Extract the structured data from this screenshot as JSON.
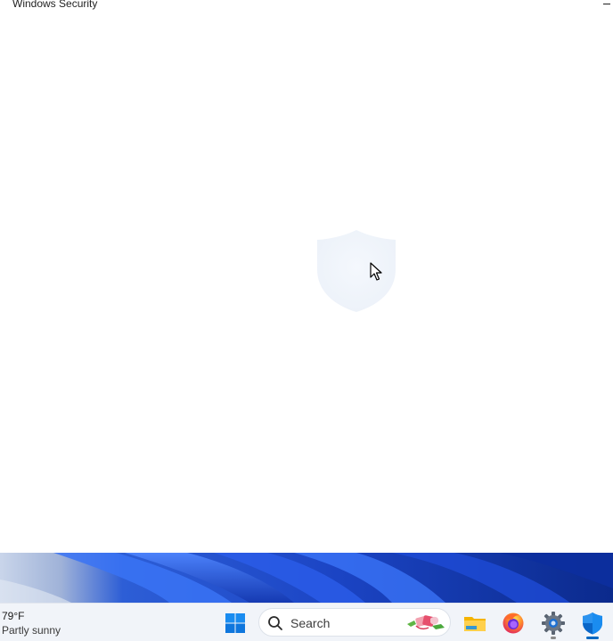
{
  "window": {
    "title": "Windows Security"
  },
  "content": {
    "loading_icon": "shield-icon"
  },
  "taskbar": {
    "weather": {
      "temperature": "79°F",
      "condition": "Partly sunny"
    },
    "search": {
      "label": "Search",
      "icon": "search-icon"
    },
    "apps": [
      {
        "name": "Start",
        "icon": "windows-logo-icon"
      },
      {
        "name": "File Explorer",
        "icon": "folder-icon"
      },
      {
        "name": "Firefox",
        "icon": "firefox-icon"
      },
      {
        "name": "Settings",
        "icon": "gear-icon"
      },
      {
        "name": "Windows Security",
        "icon": "shield-icon",
        "active": true
      }
    ]
  },
  "colors": {
    "accent": "#0067c0",
    "taskbar": "#f1f4f9",
    "wallpaper": "#1d3fb8"
  }
}
